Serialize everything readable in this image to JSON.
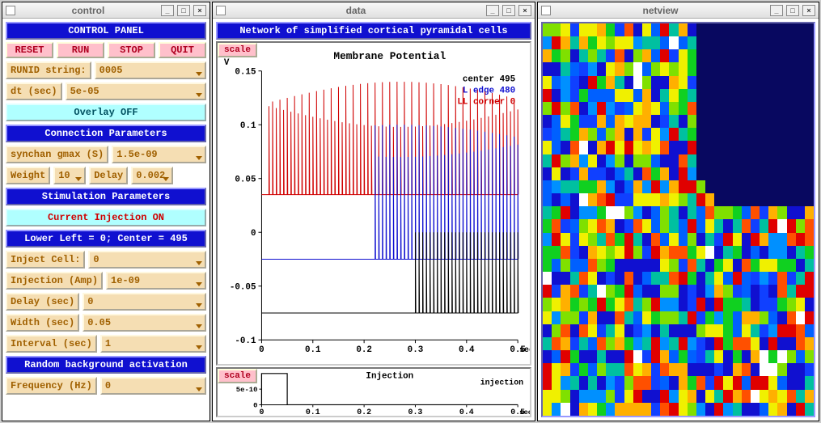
{
  "windows": {
    "control": {
      "title": "control"
    },
    "data": {
      "title": "data"
    },
    "netview": {
      "title": "netview"
    }
  },
  "control_panel": {
    "header": "CONTROL PANEL",
    "buttons": {
      "reset": "RESET",
      "run": "RUN",
      "stop": "STOP",
      "quit": "QUIT"
    },
    "runid_label": "RUNID string:",
    "runid_value": "0005",
    "dt_label": "dt (sec)",
    "dt_value": "5e-05",
    "overlay": "Overlay OFF",
    "conn_header": "Connection Parameters",
    "synchan_label": "synchan gmax (S)",
    "synchan_value": "1.5e-09",
    "weight_label": "Weight",
    "weight_value": "10",
    "delay_label": "Delay",
    "delay_value": "0.002",
    "stim_header": "Stimulation Parameters",
    "current_inj": "Current Injection ON",
    "lower_left": "Lower Left = 0; Center = 495",
    "inject_cell_label": "Inject Cell:",
    "inject_cell_value": "0",
    "inj_amp_label": "Injection (Amp)",
    "inj_amp_value": "1e-09",
    "inj_delay_label": "Delay (sec)",
    "inj_delay_value": "0",
    "inj_width_label": "Width (sec)",
    "inj_width_value": "0.05",
    "inj_interval_label": "Interval (sec)",
    "inj_interval_value": "1",
    "rand_bg_header": "Random background activation",
    "freq_label": "Frequency (Hz)",
    "freq_value": "0"
  },
  "data_panel": {
    "header": "Network of simplified cortical pyramidal cells",
    "scale_label": "scale",
    "main_title": "Membrane Potential",
    "y_unit": "V",
    "series_labels": {
      "center": "center 495",
      "edge": "L edge 480",
      "corner": "LL corner 0"
    },
    "series_colors": {
      "center": "#000000",
      "edge": "#1010d0",
      "corner": "#d00000"
    },
    "sub_title": "Injection",
    "sub_legend": "injection"
  },
  "chart_data": [
    {
      "type": "line",
      "title": "Membrane Potential",
      "xlabel": "sec",
      "ylabel": "V",
      "xlim": [
        0,
        0.5
      ],
      "ylim": [
        -0.1,
        0.15
      ],
      "xticks": [
        0,
        0.1,
        0.2,
        0.3,
        0.4,
        0.5
      ],
      "yticks": [
        -0.1,
        -0.05,
        0,
        0.05,
        0.1,
        0.15
      ],
      "series": [
        {
          "name": "center 495",
          "color": "#000000",
          "baseline": -0.075,
          "spike_peak": 0.0,
          "spike_start": 0.3,
          "spike_end": 0.5,
          "note": "flat near -0.075 V until ~0.30 s then dense spikes to ~0 V"
        },
        {
          "name": "L edge 480",
          "color": "#1010d0",
          "baseline": -0.025,
          "spike_peak": 0.1,
          "spike_start": 0.22,
          "spike_end": 0.5,
          "note": "flat near -0.025 V until ~0.22 s then dense spikes peaking ~0.10 V"
        },
        {
          "name": "LL corner 0",
          "color": "#d00000",
          "baseline": 0.035,
          "spike_peak": 0.14,
          "spike_start": 0.01,
          "spike_end": 0.5,
          "note": "dense spikes from start, baseline ~0.035 V, peaks ~0.14 V"
        }
      ]
    },
    {
      "type": "line",
      "title": "Injection",
      "xlabel": "sec",
      "ylabel": "",
      "xlim": [
        0,
        0.5
      ],
      "ylim": [
        0,
        1e-09
      ],
      "xticks": [
        0,
        0.1,
        0.2,
        0.3,
        0.4,
        0.5
      ],
      "yticks": [
        0,
        5e-10
      ],
      "series": [
        {
          "name": "injection",
          "color": "#000000",
          "x": [
            0,
            0,
            0.05,
            0.05,
            0.5
          ],
          "y": [
            0,
            1e-09,
            1e-09,
            0,
            0
          ]
        }
      ]
    }
  ]
}
